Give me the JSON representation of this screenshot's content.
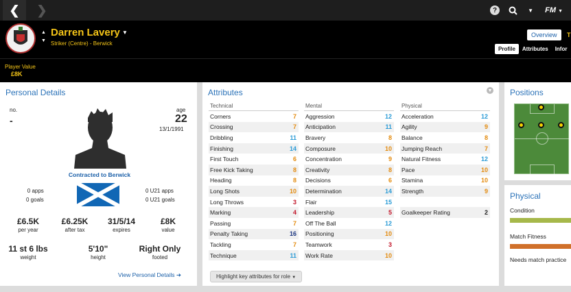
{
  "nav": {
    "back_icon": "back-arrow-icon",
    "forward_icon": "forward-arrow-icon",
    "help_icon": "help-icon",
    "search_icon": "search-icon",
    "brand": "FM"
  },
  "player": {
    "name": "Darren Lavery",
    "subtitle": "Striker (Centre) - Berwick",
    "value_label": "Player Value",
    "value": "£8K"
  },
  "tabs": {
    "overview": "Overview",
    "next_letter": "T"
  },
  "subtabs": [
    "Profile",
    "Attributes",
    "Infor"
  ],
  "personal": {
    "title": "Personal Details",
    "no_label": "no.",
    "no_value": "-",
    "age_label": "age",
    "age_value": "22",
    "dob": "13/1/1991",
    "contract": "Contracted to Berwick",
    "apps": "0 apps",
    "goals": "0 goals",
    "u21_apps": "0 U21 apps",
    "u21_goals": "0 U21 goals",
    "row1": [
      {
        "value": "£6.5K",
        "label": "per year"
      },
      {
        "value": "£6.25K",
        "label": "after tax"
      },
      {
        "value": "31/5/14",
        "label": "expires"
      },
      {
        "value": "£8K",
        "label": "value"
      }
    ],
    "row2": [
      {
        "value": "11 st 6 lbs",
        "label": "weight"
      },
      {
        "value": "5'10\"",
        "label": "height"
      },
      {
        "value": "Right Only",
        "label": "footed"
      }
    ],
    "link": "View Personal Details"
  },
  "attributes": {
    "title": "Attributes",
    "columns": [
      {
        "heading": "Technical",
        "rows": [
          {
            "name": "Corners",
            "value": "7",
            "color": "orange"
          },
          {
            "name": "Crossing",
            "value": "7",
            "color": "orange"
          },
          {
            "name": "Dribbling",
            "value": "11",
            "color": "blue"
          },
          {
            "name": "Finishing",
            "value": "14",
            "color": "blue"
          },
          {
            "name": "First Touch",
            "value": "6",
            "color": "orange"
          },
          {
            "name": "Free Kick Taking",
            "value": "8",
            "color": "orange"
          },
          {
            "name": "Heading",
            "value": "8",
            "color": "orange"
          },
          {
            "name": "Long Shots",
            "value": "10",
            "color": "orange"
          },
          {
            "name": "Long Throws",
            "value": "3",
            "color": "red"
          },
          {
            "name": "Marking",
            "value": "4",
            "color": "red"
          },
          {
            "name": "Passing",
            "value": "7",
            "color": "orange"
          },
          {
            "name": "Penalty Taking",
            "value": "16",
            "color": "navy"
          },
          {
            "name": "Tackling",
            "value": "7",
            "color": "orange"
          },
          {
            "name": "Technique",
            "value": "11",
            "color": "blue"
          }
        ]
      },
      {
        "heading": "Mental",
        "rows": [
          {
            "name": "Aggression",
            "value": "12",
            "color": "blue"
          },
          {
            "name": "Anticipation",
            "value": "11",
            "color": "blue"
          },
          {
            "name": "Bravery",
            "value": "8",
            "color": "orange"
          },
          {
            "name": "Composure",
            "value": "10",
            "color": "orange"
          },
          {
            "name": "Concentration",
            "value": "9",
            "color": "orange"
          },
          {
            "name": "Creativity",
            "value": "8",
            "color": "orange"
          },
          {
            "name": "Decisions",
            "value": "6",
            "color": "orange"
          },
          {
            "name": "Determination",
            "value": "14",
            "color": "blue"
          },
          {
            "name": "Flair",
            "value": "15",
            "color": "blue"
          },
          {
            "name": "Leadership",
            "value": "5",
            "color": "red"
          },
          {
            "name": "Off The Ball",
            "value": "12",
            "color": "blue"
          },
          {
            "name": "Positioning",
            "value": "10",
            "color": "orange"
          },
          {
            "name": "Teamwork",
            "value": "3",
            "color": "red"
          },
          {
            "name": "Work Rate",
            "value": "10",
            "color": "orange"
          }
        ]
      },
      {
        "heading": "Physical",
        "rows": [
          {
            "name": "Acceleration",
            "value": "12",
            "color": "blue"
          },
          {
            "name": "Agility",
            "value": "9",
            "color": "orange"
          },
          {
            "name": "Balance",
            "value": "8",
            "color": "orange"
          },
          {
            "name": "Jumping Reach",
            "value": "7",
            "color": "orange"
          },
          {
            "name": "Natural Fitness",
            "value": "12",
            "color": "blue"
          },
          {
            "name": "Pace",
            "value": "10",
            "color": "orange"
          },
          {
            "name": "Stamina",
            "value": "10",
            "color": "orange"
          },
          {
            "name": "Strength",
            "value": "9",
            "color": "orange"
          },
          {
            "name": "",
            "value": "",
            "color": "dark"
          },
          {
            "name": "Goalkeeper Rating",
            "value": "2",
            "color": "dark"
          }
        ]
      }
    ],
    "highlight_button": "Highlight key attributes for role"
  },
  "positions": {
    "title": "Positions"
  },
  "physical": {
    "title": "Physical",
    "condition_label": "Condition",
    "condition_level": 0.95,
    "condition_color": "#a6b84a",
    "match_fitness_label": "Match Fitness",
    "match_fitness_level": 0.95,
    "match_fitness_color": "#d0702a",
    "needs_text": "Needs match practice"
  }
}
